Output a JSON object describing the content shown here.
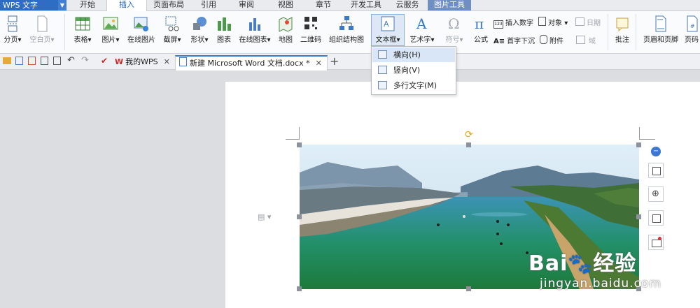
{
  "app": {
    "title": "WPS 文字"
  },
  "menu_tabs": [
    "开始",
    "插入",
    "页面布局",
    "引用",
    "审阅",
    "视图",
    "章节",
    "开发工具",
    "云服务",
    "图片工具"
  ],
  "active_tab": "插入",
  "ribbon": {
    "page_break": "分页",
    "blank_page": "空白页",
    "table": "表格",
    "picture": "图片",
    "online_picture": "在线图片",
    "screenshot": "截屏",
    "shapes": "形状",
    "chart": "图表",
    "online_chart": "在线图表",
    "map": "地图",
    "qrcode": "二维码",
    "org_chart": "组织结构图",
    "textbox": "文本框",
    "wordart": "艺术字",
    "symbol": "符号",
    "formula": "公式",
    "insert_number": "插入数字",
    "object": "对象",
    "date": "日期",
    "drop_cap": "首字下沉",
    "attachment": "附件",
    "field": "域",
    "comment": "批注",
    "header_footer": "页眉和页脚",
    "page_number": "页码"
  },
  "doc_tabs": [
    {
      "label": "我的WPS"
    },
    {
      "label": "新建 Microsoft Word 文档.docx *"
    }
  ],
  "textbox_menu": {
    "items": [
      "横向(H)",
      "竖向(V)",
      "多行文字(M)"
    ]
  },
  "watermark": {
    "brand": "Bai",
    "brand2": "经验",
    "url": "jingyan.baidu.com"
  },
  "colors": {
    "accent": "#2e6dc4",
    "picture_tab": "#6f8fc4"
  }
}
